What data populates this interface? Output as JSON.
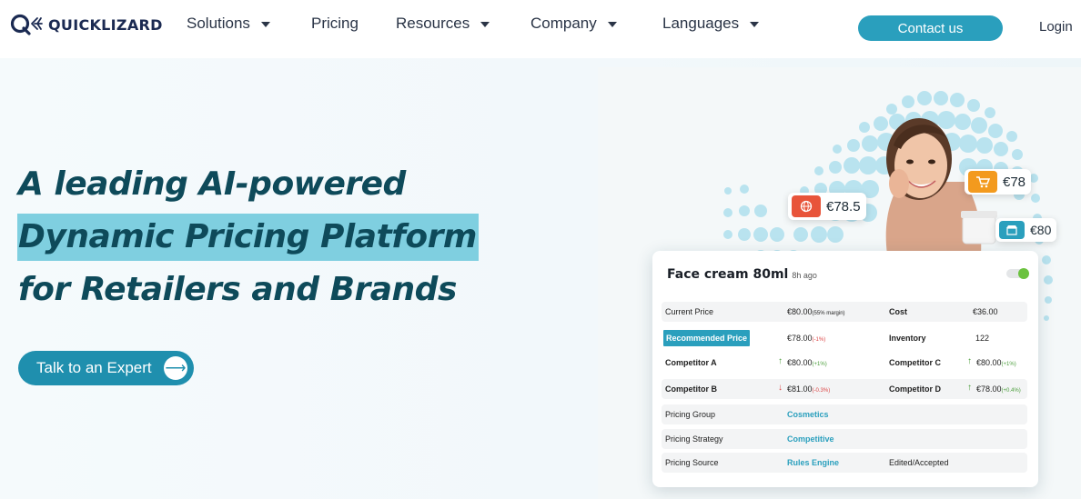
{
  "nav": {
    "logo_text": "QUICKLIZARD",
    "items": [
      {
        "label": "Solutions",
        "dropdown": true
      },
      {
        "label": "Pricing",
        "dropdown": false
      },
      {
        "label": "Resources",
        "dropdown": true
      },
      {
        "label": "Company",
        "dropdown": true
      },
      {
        "label": "Languages",
        "dropdown": true
      }
    ],
    "contact_label": "Contact us",
    "login_label": "Login"
  },
  "hero": {
    "headline_line1": "A leading AI-powered",
    "headline_line2": "Dynamic Pricing Platform",
    "headline_line3": "for Retailers and Brands",
    "cta_label": "Talk to an Expert",
    "cta_arrow": "⟶"
  },
  "tags": {
    "www": {
      "icon_label": "www",
      "price": "€78.5"
    },
    "marketplace": {
      "icon_label": "Marketplace",
      "price": "€78"
    },
    "instore": {
      "icon_label": "INSTORE",
      "price": "€80"
    }
  },
  "card": {
    "title": "Face cream 80ml",
    "subtitle": "8h ago",
    "rows": {
      "current_price_label": "Current Price",
      "current_price_value": "€80.00",
      "current_price_note": "(55% margin)",
      "cost_label": "Cost",
      "cost_value": "€36.00",
      "recommended_label": "Recommended Price",
      "recommended_value": "€78.00",
      "recommended_note": "(-1%)",
      "inventory_label": "Inventory",
      "inventory_value": "122",
      "comp_a_label": "Competitor A",
      "comp_a_value": "€80.00",
      "comp_a_note": "(+1%)",
      "comp_c_label": "Competitor C",
      "comp_c_value": "€80.00",
      "comp_c_note": "(+1%)",
      "comp_b_label": "Competitor B",
      "comp_b_value": "€81.00",
      "comp_b_note": "(-0.3%)",
      "comp_d_label": "Competitor D",
      "comp_d_value": "€78.00",
      "comp_d_note": "(+0.4%)",
      "group_label": "Pricing Group",
      "group_value": "Cosmetics",
      "strategy_label": "Pricing Strategy",
      "strategy_value": "Competitive",
      "source_label": "Pricing Source",
      "source_value": "Rules Engine",
      "source_status": "Edited/Accepted"
    }
  },
  "colors": {
    "brand_teal": "#2a9fbd",
    "headline": "#0e4a5a",
    "highlight": "#7fcfe0",
    "www_tag": "#e8543a",
    "marketplace_tag": "#f39a1e",
    "instore_tag": "#2a9fbd"
  }
}
